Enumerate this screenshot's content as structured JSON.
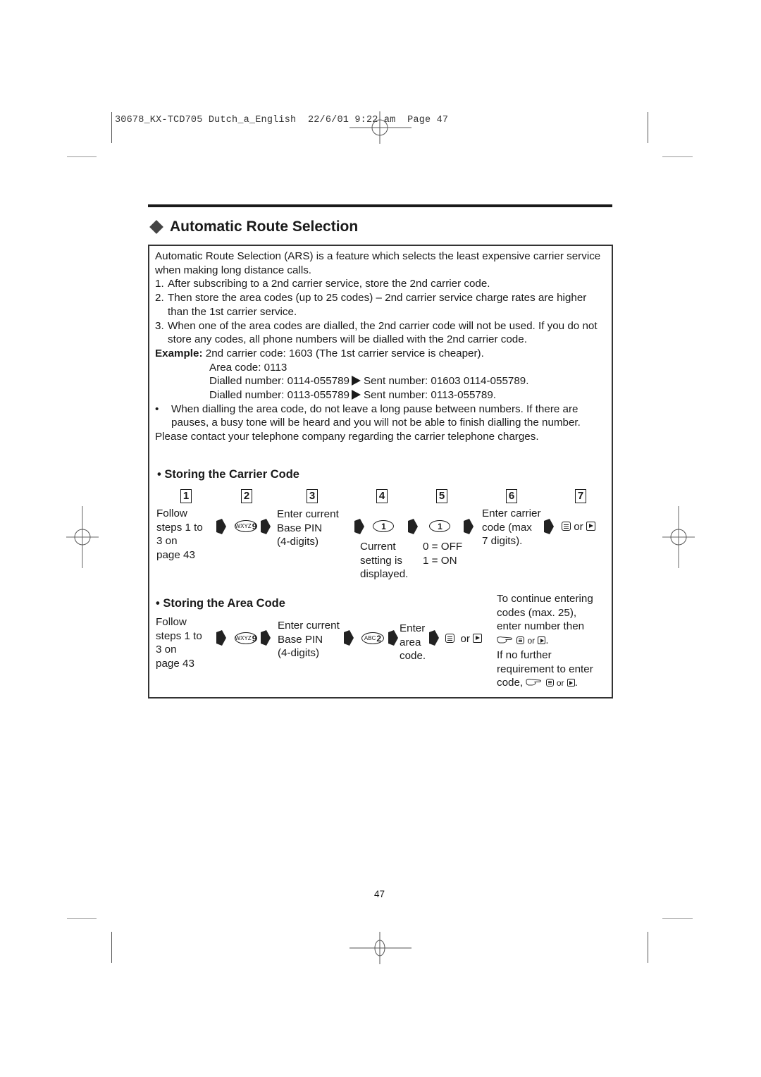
{
  "print_slug": {
    "job": "30678_KX-TCD705 Dutch_a_English",
    "date": "22/6/01",
    "time": "9:22 am",
    "page": "Page 47"
  },
  "section": {
    "title": "Automatic Route Selection",
    "icon": "diamond-bullet-icon"
  },
  "intro": {
    "text": "Automatic Route Selection (ARS) is a feature which selects the least expensive carrier service when making long distance calls.",
    "items": [
      {
        "num": "1.",
        "text": "After subscribing to a 2nd carrier service, store the 2nd carrier code."
      },
      {
        "num": "2.",
        "text": "Then store the area codes (up to 25 codes) – 2nd carrier service charge rates are higher than the 1st carrier service."
      },
      {
        "num": "3.",
        "text": "When one of the area codes are dialled, the 2nd carrier code will not be used. If you do not store any codes, all phone numbers will be dialled with the 2nd carrier code."
      }
    ],
    "example_label": "Example:",
    "example_text": "2nd carrier code: 1603 (The 1st carrier service is cheaper).",
    "example_area_code": "Area code: 0113",
    "example_lines": [
      {
        "dialled": "Dialled number: 0114-055789",
        "sent": "Sent number: 01603 0114-055789."
      },
      {
        "dialled": "Dialled number: 0113-055789",
        "sent": "Sent number: 0113-055789."
      }
    ],
    "bullet": "•",
    "bullet_text": "When dialling the area code, do not leave a long pause between numbers. If there are pauses, a busy tone will be heard and you will not be able to finish dialling the number.",
    "contact_text": "Please contact your telephone company regarding the carrier telephone charges."
  },
  "carrier_code": {
    "heading": "• Storing the Carrier Code",
    "step_numbers": [
      "1",
      "2",
      "3",
      "4",
      "5",
      "6",
      "7"
    ],
    "step1": [
      "Follow",
      "steps 1 to",
      "3 on",
      "page 43"
    ],
    "step2_key": {
      "letters": "WXYZ",
      "digit": "9"
    },
    "step3": [
      "Enter current",
      "Base PIN",
      "(4-digits)"
    ],
    "step4_key": {
      "letters": "",
      "digit": "1"
    },
    "step4_note": [
      "Current",
      "setting is",
      "displayed."
    ],
    "step5_key": {
      "letters": "",
      "digit": "1"
    },
    "step5_note": [
      "0 = OFF",
      "1 = ON"
    ],
    "step6": [
      "Enter carrier",
      "code (max",
      "7 digits)."
    ],
    "step7_or": "or"
  },
  "area_code": {
    "heading": "• Storing the Area Code",
    "step1": [
      "Follow",
      "steps 1 to",
      "3 on",
      "page 43"
    ],
    "key1": {
      "letters": "WXYZ",
      "digit": "9"
    },
    "step2": [
      "Enter current",
      "Base PIN",
      "(4-digits)"
    ],
    "key2": {
      "letters": "ABC",
      "digit": "2"
    },
    "step3": [
      "Enter",
      "area",
      "code."
    ],
    "or": "or",
    "note": {
      "line1": "To continue entering",
      "line2": "codes (max. 25),",
      "line3": "enter number then",
      "or_a": "or",
      "line5": "If no further",
      "line6": "requirement to enter",
      "line7_prefix": "code,",
      "or_b": "or"
    }
  },
  "footer": {
    "page_number": "47"
  }
}
